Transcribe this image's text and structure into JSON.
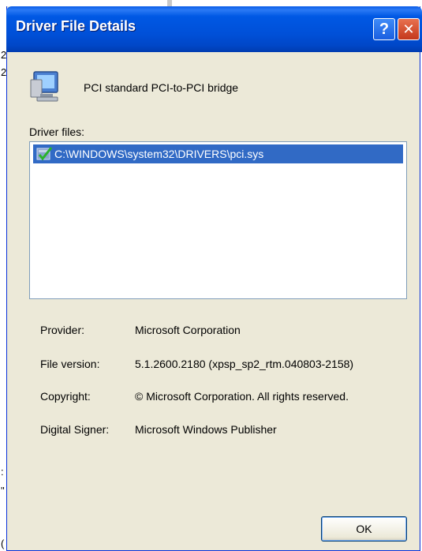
{
  "background": {
    "chars": [
      "2",
      "2",
      ":",
      "\"",
      "("
    ]
  },
  "dialog": {
    "title": "Driver File Details",
    "help_glyph": "?",
    "close_glyph": "✕",
    "device_name": "PCI standard PCI-to-PCI bridge",
    "files_label": "Driver files:",
    "files": [
      "C:\\WINDOWS\\system32\\DRIVERS\\pci.sys"
    ],
    "details": [
      {
        "label": "Provider:",
        "value": "Microsoft Corporation"
      },
      {
        "label": "File version:",
        "value": "5.1.2600.2180 (xpsp_sp2_rtm.040803-2158)"
      },
      {
        "label": "Copyright:",
        "value": "© Microsoft Corporation. All rights reserved."
      },
      {
        "label": "Digital Signer:",
        "value": "Microsoft Windows Publisher"
      }
    ],
    "ok_label": "OK"
  },
  "icons": {
    "device": "computer-monitor-icon",
    "file": "signed-driver-file-icon",
    "help": "help-icon",
    "close": "close-icon"
  },
  "colors": {
    "title_bar": "#0054e3",
    "selection": "#316ac5",
    "dialog_bg": "#ece9d8",
    "close_red": "#d4472a"
  }
}
